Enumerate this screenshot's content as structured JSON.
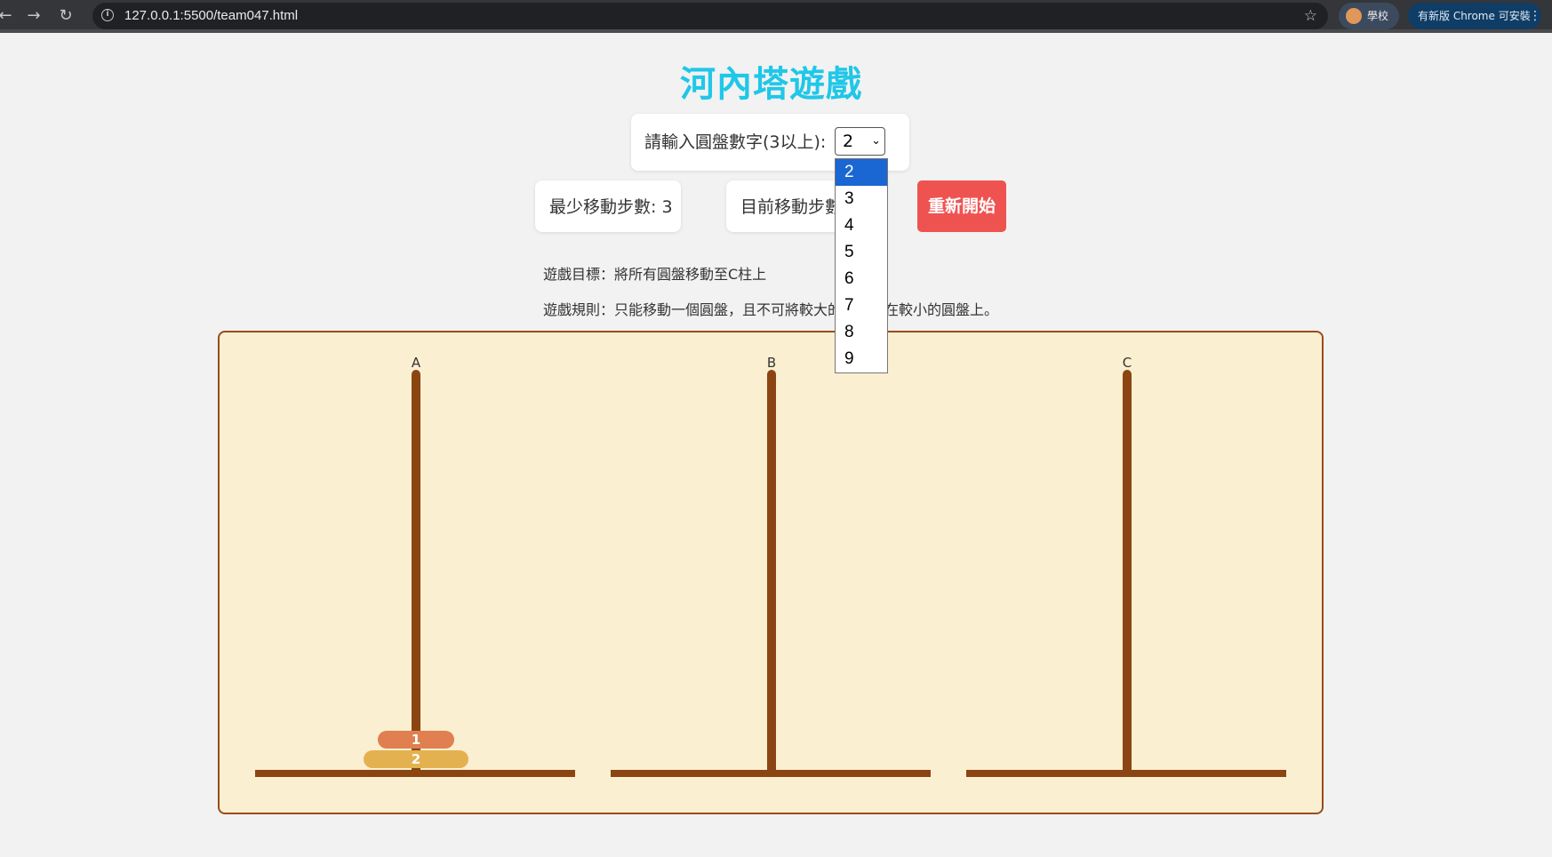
{
  "browser": {
    "back_icon": "arrow-left-icon",
    "forward_icon": "arrow-right-icon",
    "reload_icon": "reload-icon",
    "url": "127.0.0.1:5500/team047.html",
    "profile_label": "學校",
    "update_label": "有新版 Chrome 可安裝"
  },
  "page": {
    "title": "河內塔遊戲",
    "title_color": "#1fc7e8"
  },
  "controls": {
    "disk_input_label": "請輸入圓盤數字(3以上):",
    "disk_select_value": "2",
    "disk_options": [
      "2",
      "3",
      "4",
      "5",
      "6",
      "7",
      "8",
      "9"
    ],
    "min_moves_label": "最少移動步數: 3",
    "current_moves_label": "目前移動步數: 0",
    "restart_label": "重新開始",
    "restart_color": "#ef5350"
  },
  "info": {
    "goal": "遊戲目標：將所有圓盤移動至C柱上",
    "rule": "遊戲規則：只能移動一個圓盤，且不可將較大的圓盤放在較小的圓盤上。"
  },
  "board": {
    "pegs": [
      {
        "label": "A",
        "disks": [
          {
            "number": "1",
            "color": "#e07f4f"
          },
          {
            "number": "2",
            "color": "#e3b14f"
          }
        ]
      },
      {
        "label": "B",
        "disks": []
      },
      {
        "label": "C",
        "disks": []
      }
    ],
    "rod_color": "#8b4513"
  }
}
